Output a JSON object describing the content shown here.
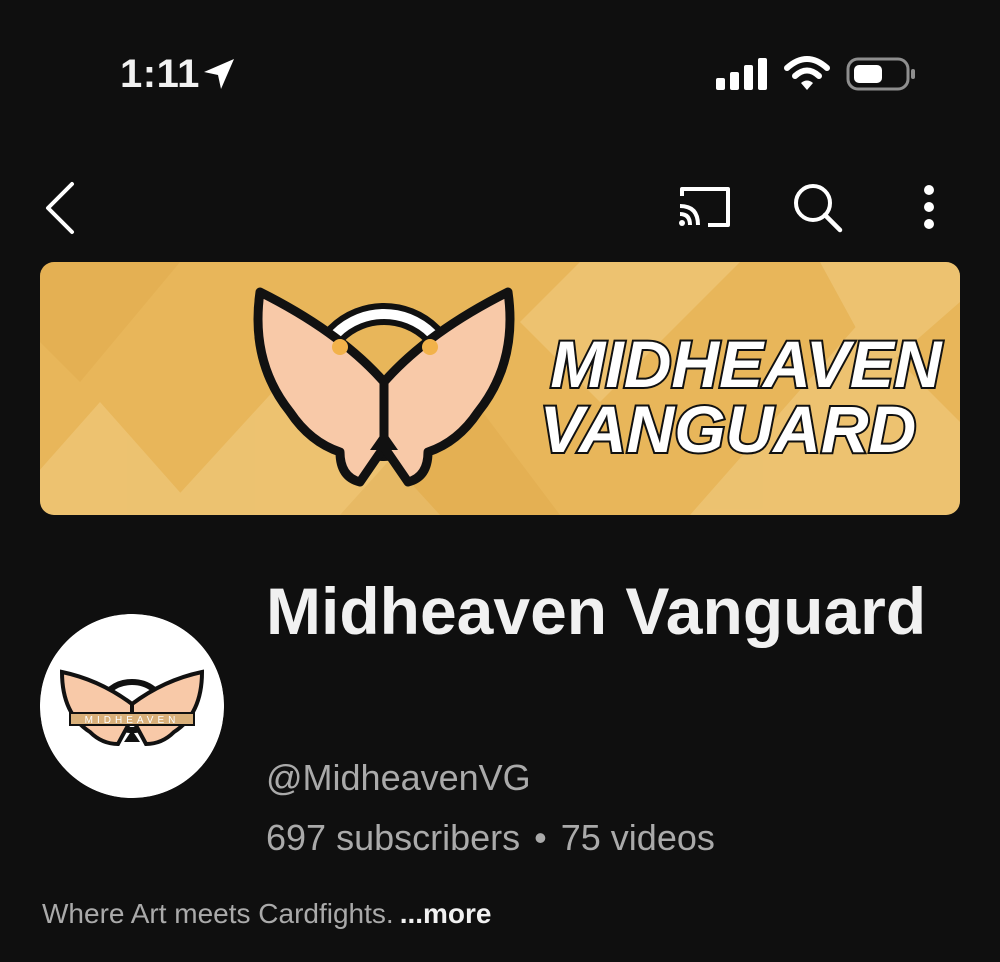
{
  "status_bar": {
    "time": "1:11",
    "icons": [
      "location-arrow-icon",
      "cellular-signal-icon",
      "wifi-icon",
      "battery-icon"
    ]
  },
  "header": {
    "icons": [
      "back-chevron-icon",
      "cast-icon",
      "search-icon",
      "more-vertical-icon"
    ]
  },
  "banner": {
    "line1": "MIDHEAVEN",
    "line2": "VANGUARD",
    "background_color": "#e8b65a",
    "logo": "winged-halo-logo"
  },
  "avatar": {
    "lettering": "MIDHEAVEN",
    "logo": "winged-halo-logo"
  },
  "channel": {
    "name": "Midheaven Vanguard",
    "handle": "@MidheavenVG",
    "subscribers": "697 subscribers",
    "separator": "•",
    "videos": "75 videos",
    "description": "Where Art meets Cardfights.",
    "more_label": "...more"
  },
  "colors": {
    "background": "#0f0f0f",
    "primary_text": "#f1f1f1",
    "secondary_text": "#aaaaaa"
  }
}
